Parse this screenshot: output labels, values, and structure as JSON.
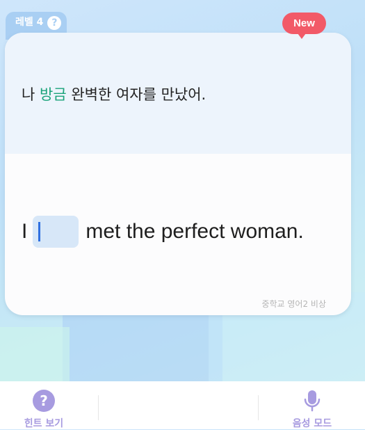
{
  "level": {
    "label": "레벨 4",
    "help_icon": "question-icon"
  },
  "badge": {
    "label": "New"
  },
  "card": {
    "korean_prefix": "나 ",
    "korean_highlight": "방금",
    "korean_suffix": " 완벽한 여자를 만났어.",
    "english_prefix": "I",
    "english_blank_value": "",
    "english_suffix": "met the perfect woman.",
    "source": "중학교 영어2 비상"
  },
  "bottom": {
    "hint_label": "힌트 보기",
    "hint_icon": "question-circle-icon",
    "voice_label": "음성 모드",
    "voice_icon": "microphone-icon"
  },
  "colors": {
    "accent": "#a79be0",
    "highlight": "#1aa37a",
    "badge": "#f25a68",
    "blank": "#d7e7f8",
    "caret": "#2f6fe0"
  }
}
